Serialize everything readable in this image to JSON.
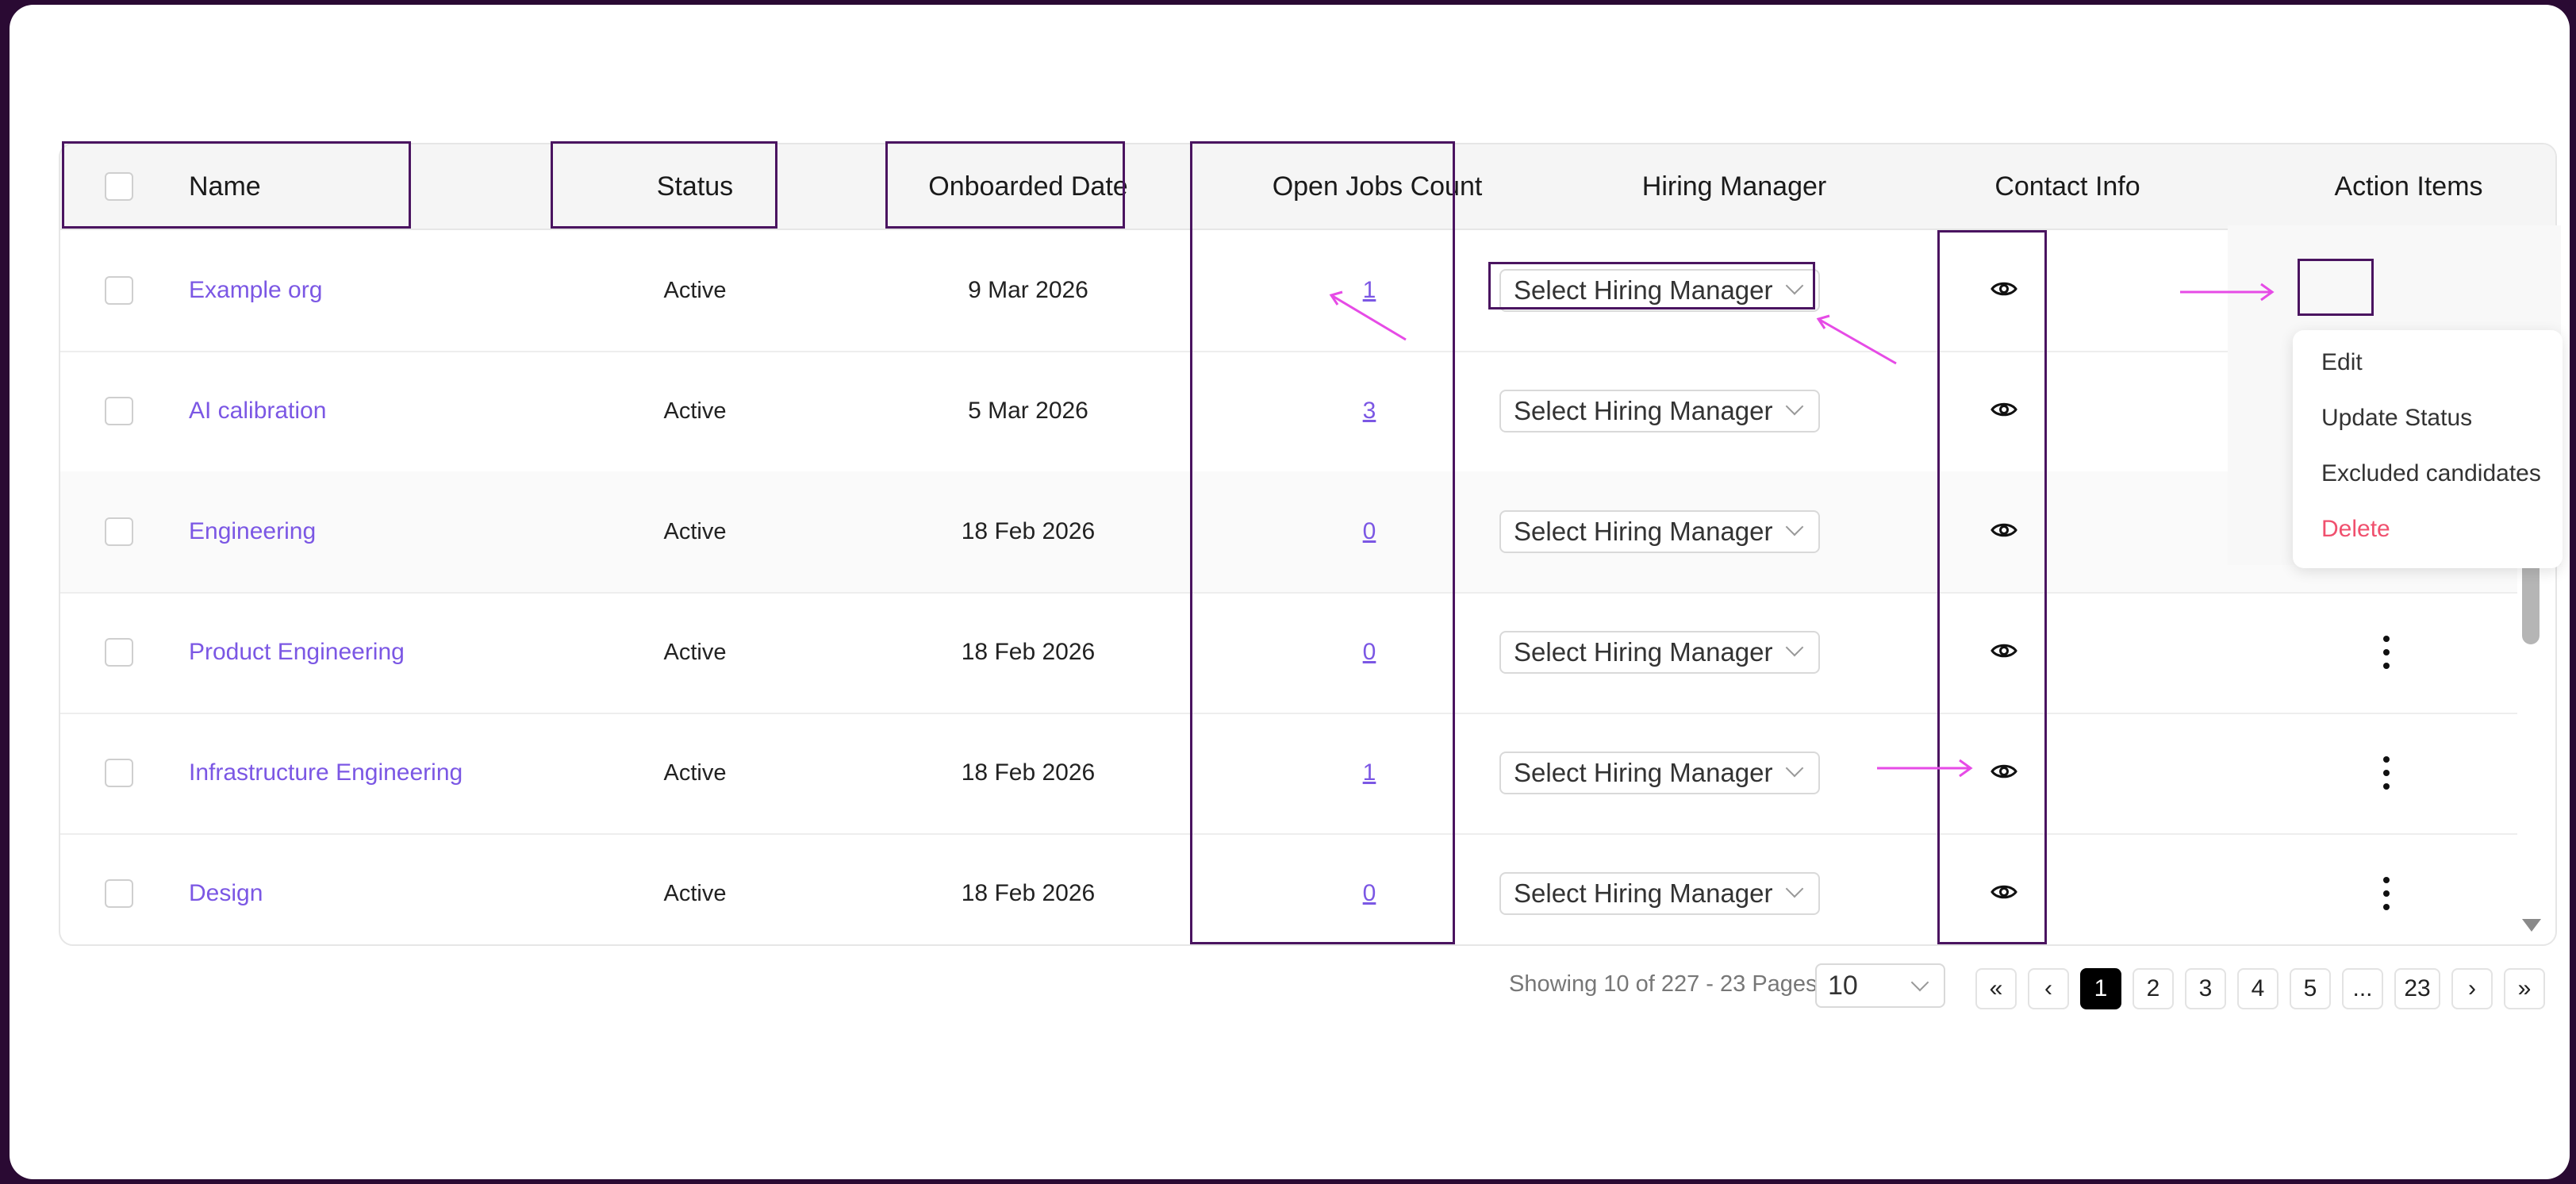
{
  "table": {
    "headers": {
      "name": "Name",
      "status": "Status",
      "onboarded": "Onboarded Date",
      "open_jobs": "Open Jobs Count",
      "hiring_manager": "Hiring Manager",
      "contact": "Contact Info",
      "actions": "Action Items"
    },
    "rows": [
      {
        "name": "Example org",
        "status": "Active",
        "date": "9 Mar 2026",
        "count": "1",
        "hiring_manager": "Select Hiring Manager"
      },
      {
        "name": "AI calibration",
        "status": "Active",
        "date": "5 Mar 2026",
        "count": "3",
        "hiring_manager": "Select Hiring Manager"
      },
      {
        "name": "Engineering",
        "status": "Active",
        "date": "18 Feb 2026",
        "count": "0",
        "hiring_manager": "Select Hiring Manager"
      },
      {
        "name": "Product Engineering",
        "status": "Active",
        "date": "18 Feb 2026",
        "count": "0",
        "hiring_manager": "Select Hiring Manager"
      },
      {
        "name": "Infrastructure Engineering",
        "status": "Active",
        "date": "18 Feb 2026",
        "count": "1",
        "hiring_manager": "Select Hiring Manager"
      },
      {
        "name": "Design",
        "status": "Active",
        "date": "18 Feb 2026",
        "count": "0",
        "hiring_manager": "Select Hiring Manager"
      }
    ]
  },
  "action_menu": {
    "items": [
      "Edit",
      "Update Status",
      "Excluded candidates",
      "Delete"
    ],
    "danger_color": "#f0506e"
  },
  "pagination": {
    "summary": "Showing 10 of 227 - 23 Pages",
    "page_size": "10",
    "pages": [
      "1",
      "2",
      "3",
      "4",
      "5",
      "...",
      "23"
    ],
    "current": "1",
    "first_icon": "«",
    "prev_icon": "‹",
    "next_icon": "›",
    "last_icon": "»"
  },
  "colors": {
    "accent": "#7b57e4",
    "highlight_box": "#4a1460",
    "annotation_arrow": "#e64be6"
  },
  "icons": {
    "view": "eye-icon",
    "actions": "kebab-icon",
    "dropdown": "chevron-down-icon"
  }
}
